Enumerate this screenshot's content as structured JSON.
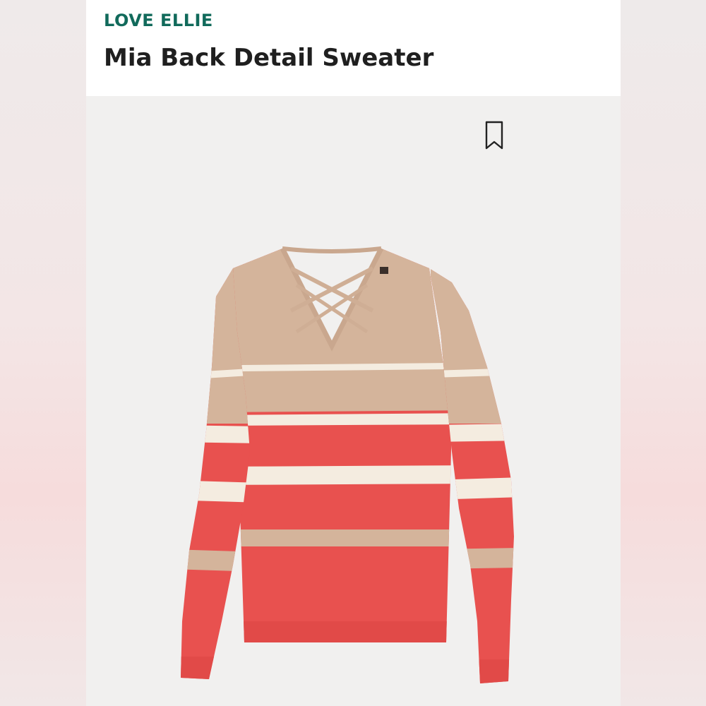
{
  "brand": "LOVE ELLIE",
  "product_title": "Mia Back Detail Sweater",
  "icons": {
    "save": "bookmark-icon"
  },
  "colors": {
    "brand_green": "#116a5b",
    "title_text": "#1f1f1f",
    "sweater_tan": "#d4b49b",
    "sweater_coral": "#e8514f",
    "sweater_cream": "#f4ece0"
  }
}
